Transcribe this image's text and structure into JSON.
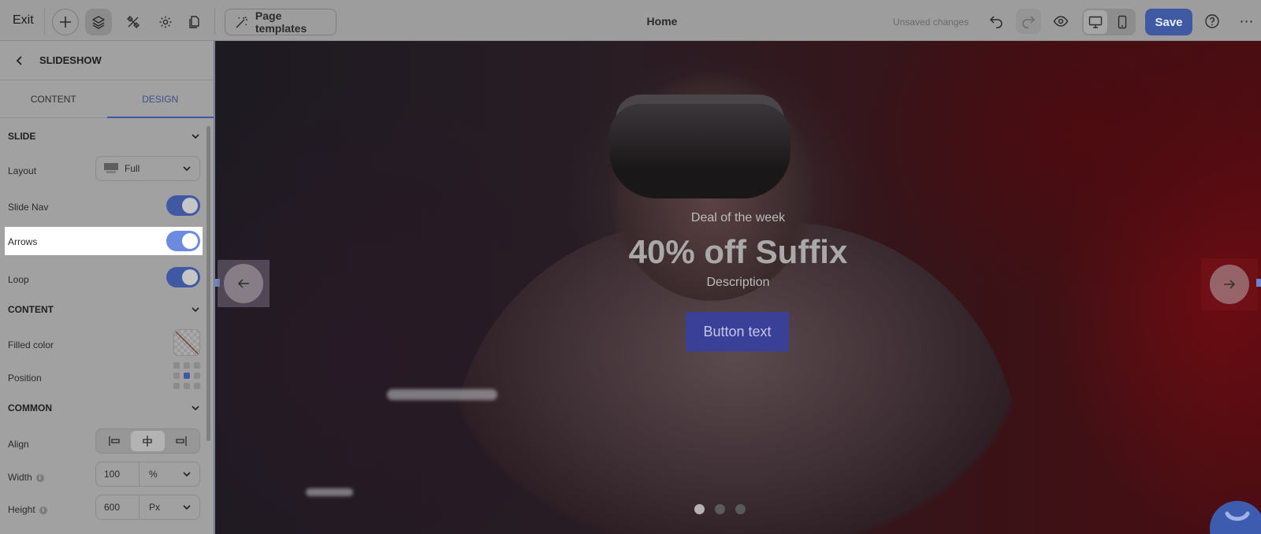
{
  "topbar": {
    "exit_label": "Exit",
    "page_templates_label": "Page templates",
    "page_title": "Home",
    "status": "Unsaved changes",
    "save_label": "Save",
    "more_label": "⋯"
  },
  "sidebar": {
    "title": "SLIDESHOW",
    "tabs": [
      {
        "label": "CONTENT",
        "active": false
      },
      {
        "label": "DESIGN",
        "active": true
      }
    ],
    "slide_section": "SLIDE",
    "layout_label": "Layout",
    "layout_value": "Full",
    "slide_nav_label": "Slide Nav",
    "slide_nav_on": true,
    "arrows_label": "Arrows",
    "arrows_on": true,
    "loop_label": "Loop",
    "loop_on": true,
    "content_section": "CONTENT",
    "filled_color_label": "Filled color",
    "position_label": "Position",
    "common_section": "COMMON",
    "align_label": "Align",
    "align_value": "center",
    "width_label": "Width",
    "width_value": "100",
    "width_unit": "%",
    "height_label": "Height",
    "height_value": "600",
    "height_unit": "Px"
  },
  "hero": {
    "eyebrow": "Deal of the week",
    "headline": "40% off Suffix",
    "description": "Description",
    "button_label": "Button text",
    "slide_count": 3,
    "active_slide": 1
  },
  "colors": {
    "accent": "#3f5aa3",
    "toggle_highlight": "#6a8be0",
    "cta": "#3a3f98"
  }
}
